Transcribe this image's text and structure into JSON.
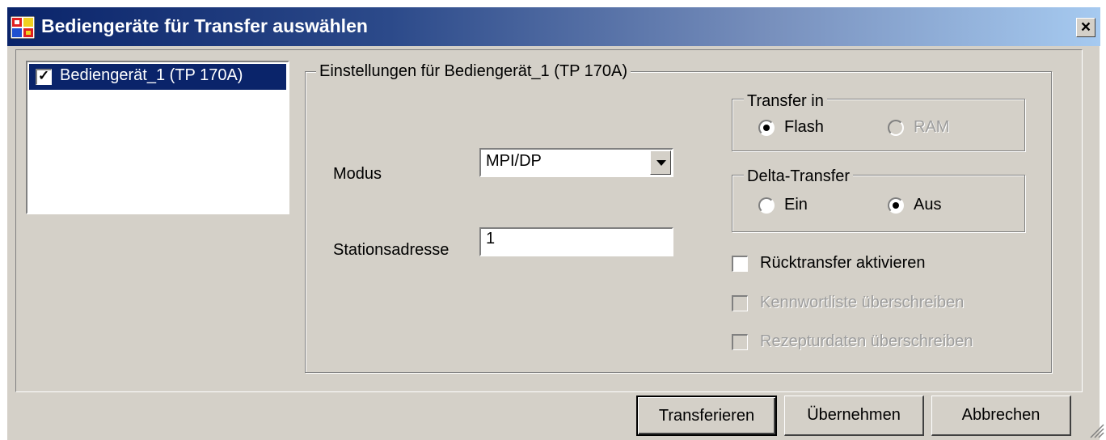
{
  "window": {
    "title": "Bediengeräte für Transfer auswählen",
    "close_label": "×"
  },
  "device_list": {
    "items": [
      {
        "label": "Bediengerät_1 (TP 170A)",
        "checked": true,
        "selected": true
      }
    ]
  },
  "settings": {
    "group_title": "Einstellungen für Bediengerät_1 (TP 170A)",
    "modus_label": "Modus",
    "modus_value": "MPI/DP",
    "station_label": "Stationsadresse",
    "station_value": "1"
  },
  "transfer_in": {
    "title": "Transfer in",
    "options": [
      {
        "label": "Flash",
        "selected": true,
        "enabled": true
      },
      {
        "label": "RAM",
        "selected": false,
        "enabled": false
      }
    ]
  },
  "delta_transfer": {
    "title": "Delta-Transfer",
    "options": [
      {
        "label": "Ein",
        "selected": false,
        "enabled": true
      },
      {
        "label": "Aus",
        "selected": true,
        "enabled": true
      }
    ]
  },
  "checkboxes": [
    {
      "label": "Rücktransfer aktivieren",
      "checked": false,
      "enabled": true
    },
    {
      "label": "Kennwortliste überschreiben",
      "checked": false,
      "enabled": false
    },
    {
      "label": "Rezepturdaten überschreiben",
      "checked": false,
      "enabled": false
    }
  ],
  "buttons": {
    "transfer": "Transferieren",
    "apply": "Übernehmen",
    "cancel": "Abbrechen"
  },
  "colors": {
    "title_gradient_start": "#0a246a",
    "title_gradient_end": "#a6caf0",
    "face": "#d4d0c8",
    "selection": "#0a246a"
  }
}
